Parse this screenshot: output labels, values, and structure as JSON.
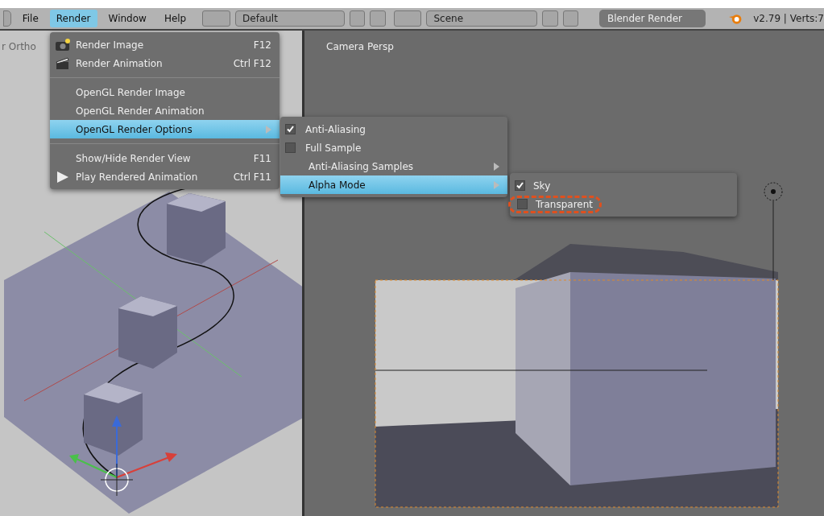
{
  "menubar": {
    "items": [
      {
        "label": "File",
        "selected": false
      },
      {
        "label": "Render",
        "selected": true
      },
      {
        "label": "Window",
        "selected": false
      },
      {
        "label": "Help",
        "selected": false
      }
    ],
    "layout": "Default",
    "scene": "Scene",
    "engine": "Blender Render",
    "status": "v2.79 | Verts:7"
  },
  "left_view": {
    "title": "r Ortho"
  },
  "right_view": {
    "title": "Camera Persp"
  },
  "render_menu": [
    {
      "kind": "item",
      "label": "Render Image",
      "shortcut": "F12",
      "selected": false
    },
    {
      "kind": "item",
      "label": "Render Animation",
      "shortcut": "Ctrl F12",
      "selected": false
    },
    {
      "kind": "separator"
    },
    {
      "kind": "item",
      "label": "OpenGL Render Image",
      "selected": false
    },
    {
      "kind": "item",
      "label": "OpenGL Render Animation",
      "selected": false
    },
    {
      "kind": "submenu",
      "label": "OpenGL Render Options",
      "selected": true
    },
    {
      "kind": "separator"
    },
    {
      "kind": "item",
      "label": "Show/Hide Render View",
      "shortcut": "F11",
      "selected": false
    },
    {
      "kind": "item",
      "label": "Play Rendered Animation",
      "shortcut": "Ctrl F11",
      "selected": false
    }
  ],
  "options_menu": [
    {
      "kind": "check",
      "label": "Anti-Aliasing",
      "checked": true
    },
    {
      "kind": "check",
      "label": "Full Sample",
      "checked": false
    },
    {
      "kind": "submenu",
      "label": "Anti-Aliasing Samples",
      "selected": false
    },
    {
      "kind": "submenu",
      "label": "Alpha Mode",
      "selected": true
    }
  ],
  "alpha_menu": [
    {
      "label": "Sky",
      "checked": true,
      "circled": false
    },
    {
      "label": "Transparent",
      "checked": false,
      "circled": true
    }
  ]
}
